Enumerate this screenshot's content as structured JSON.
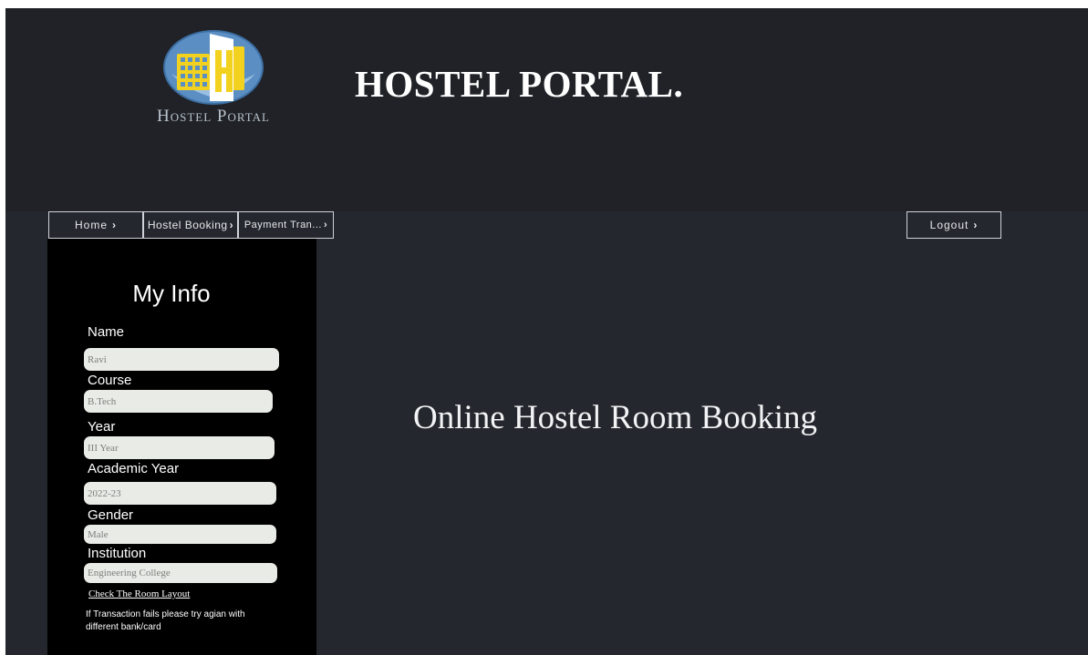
{
  "header": {
    "logo_text": "Hostel Portal",
    "title": "HOSTEL PORTAL."
  },
  "nav": {
    "items": [
      {
        "label": "Home"
      },
      {
        "label": "Hostel Booking"
      },
      {
        "label": "Payment Tran..."
      }
    ],
    "logout": "Logout",
    "chevron": "›"
  },
  "sidebar": {
    "title": "My Info",
    "fields": [
      {
        "label": "Name",
        "value": "Ravi"
      },
      {
        "label": "Course",
        "value": "B.Tech"
      },
      {
        "label": "Year",
        "value": "III Year"
      },
      {
        "label": "Academic Year",
        "value": "2022-23"
      },
      {
        "label": "Gender",
        "value": "Male"
      },
      {
        "label": "Institution",
        "value": "Engineering College"
      }
    ],
    "link": "Check The Room Layout",
    "note": "If Transaction fails please try agian with different bank/card"
  },
  "main": {
    "heading": "Online Hostel Room Booking"
  },
  "colors": {
    "background": "#24272d",
    "header": "#202227",
    "sidebar": "#000000",
    "logo_yellow": "#f2d21e",
    "logo_blue": "#5b8fc4"
  }
}
